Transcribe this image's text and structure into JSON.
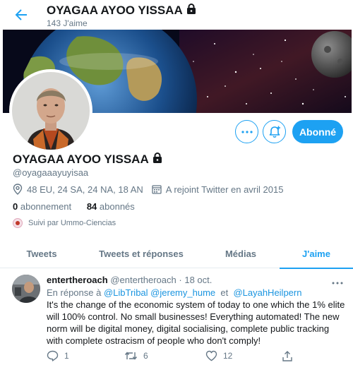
{
  "header": {
    "title": "OYAGAA AYOO YISSAA",
    "likes_count": "143 J'aime"
  },
  "profile": {
    "name": "OYAGAA AYOO YISSAA",
    "handle": "@oyagaaayuyisaa",
    "location": "48 EU, 24 SA, 24 NA, 18 AN",
    "joined": "A rejoint Twitter en avril 2015",
    "following_count": "0",
    "following_label": "abonnement",
    "followers_count": "84",
    "followers_label": "abonnés",
    "followed_by": "Suivi par Ummo-Ciencias",
    "follow_button": "Abonné"
  },
  "tabs": [
    {
      "label": "Tweets"
    },
    {
      "label": "Tweets et réponses"
    },
    {
      "label": "Médias"
    },
    {
      "label": "J'aime",
      "active": true
    }
  ],
  "tweet": {
    "author_name": "entertheroach",
    "author_handle": "@entertheroach",
    "separator": "·",
    "date": "18 oct.",
    "reply_prefix": "En réponse à",
    "reply_to_1": "@LibTribal",
    "reply_to_2": "@jeremy_hume",
    "reply_conj": "et",
    "reply_to_3": "@LayahHeilpern",
    "text": "It's the change of the economic system of today to one which the 1% elite will 100% control. No small businesses! Everything automated! The new norm will be digital money, digital socialising, complete public tracking with complete ostracism of people who don't comply!",
    "replies": "1",
    "retweets": "6",
    "likes": "12"
  },
  "colors": {
    "accent": "#1da1f2",
    "muted": "#657786",
    "text": "#14171a"
  }
}
